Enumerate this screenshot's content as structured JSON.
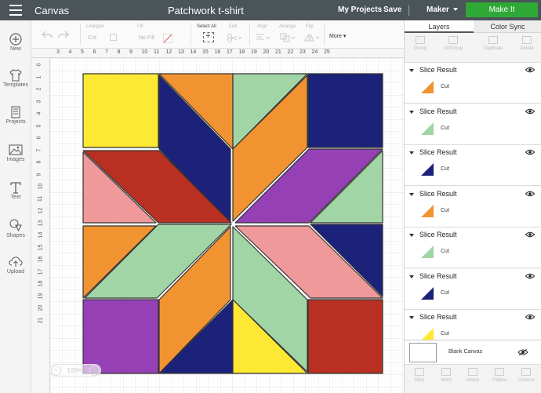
{
  "topbar": {
    "app_title": "Canvas",
    "project_title": "Patchwork t-shirt",
    "my_projects": "My Projects",
    "save": "Save",
    "machine": "Maker",
    "make_it": "Make It"
  },
  "sidebar": {
    "items": [
      {
        "label": "New",
        "icon": "plus-circle-icon"
      },
      {
        "label": "Templates",
        "icon": "tshirt-icon"
      },
      {
        "label": "Projects",
        "icon": "projects-icon"
      },
      {
        "label": "Images",
        "icon": "image-icon"
      },
      {
        "label": "Text",
        "icon": "text-icon"
      },
      {
        "label": "Shapes",
        "icon": "shapes-icon"
      },
      {
        "label": "Upload",
        "icon": "upload-icon"
      }
    ]
  },
  "toolbar": {
    "linetype_label": "Linetype",
    "linetype_value": "Cut",
    "fill_label": "Fill",
    "fill_value": "No Fill",
    "select_all": "Select All",
    "edit": "Edit",
    "align": "Align",
    "arrange": "Arrange",
    "flip": "Flip",
    "more": "More"
  },
  "ruler": {
    "top": [
      "3",
      "4",
      "5",
      "6",
      "7",
      "8",
      "9",
      "10",
      "11",
      "12",
      "13",
      "14",
      "15",
      "16",
      "17",
      "18",
      "19",
      "20",
      "21",
      "22",
      "23",
      "24",
      "25"
    ],
    "left": [
      "0",
      "1",
      "2",
      "3",
      "4",
      "5",
      "6",
      "7",
      "8",
      "9",
      "10",
      "11",
      "12",
      "13",
      "14",
      "15",
      "16",
      "17",
      "18",
      "19",
      "20",
      "21"
    ]
  },
  "zoom": {
    "value": "100%"
  },
  "quilt": {
    "colors": {
      "yellow": "#fde933",
      "orange": "#f29332",
      "navy": "#1c227a",
      "green": "#a2d5a5",
      "red": "#b93022",
      "pink": "#f0999a",
      "purple": "#9541b5"
    }
  },
  "panel": {
    "tab_layers": "Layers",
    "tab_color_sync": "Color Sync",
    "tools": [
      "Group",
      "UnGroup",
      "Duplicate",
      "Delete"
    ],
    "layers": [
      {
        "title": "Slice Result",
        "sub": "Cut",
        "color": "#f29332"
      },
      {
        "title": "Slice Result",
        "sub": "Cut",
        "color": "#a2d5a5"
      },
      {
        "title": "Slice Result",
        "sub": "Cut",
        "color": "#1c227a"
      },
      {
        "title": "Slice Result",
        "sub": "Cut",
        "color": "#f29332"
      },
      {
        "title": "Slice Result",
        "sub": "Cut",
        "color": "#a2d5a5"
      },
      {
        "title": "Slice Result",
        "sub": "Cut",
        "color": "#1c227a"
      },
      {
        "title": "Slice Result",
        "sub": "Cut",
        "color": "#fde933"
      }
    ],
    "blank_canvas": "Blank Canvas",
    "bottom_tools": [
      "Slice",
      "Weld",
      "Attach",
      "Flatten",
      "Contour"
    ]
  }
}
